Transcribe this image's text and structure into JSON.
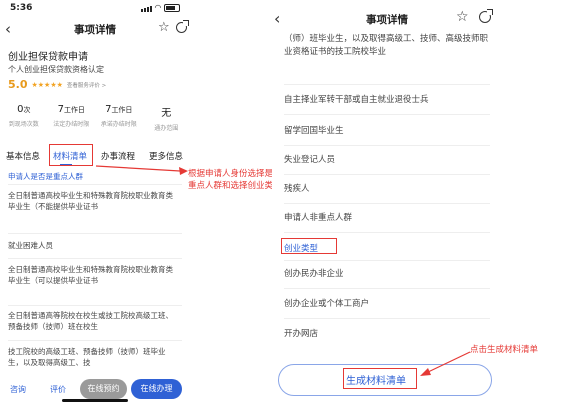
{
  "left": {
    "status": {
      "time": "5:36"
    },
    "navbar": {
      "title": "事项详情"
    },
    "service": {
      "title": "创业担保贷款申请",
      "subtitle": "个人创业担保贷款资格认定",
      "rating": "5.0",
      "stars": "★★★★★",
      "rating_link": "查看服务评价 >"
    },
    "stats": [
      {
        "value": "0",
        "unit": "次",
        "label": "到现场次数"
      },
      {
        "value": "7",
        "unit": "工作日",
        "label": "法定办结时限"
      },
      {
        "value": "7",
        "unit": "工作日",
        "label": "承诺办结时限"
      },
      {
        "value": "无",
        "unit": "",
        "label": "通办范围"
      }
    ],
    "tabs": [
      "基本信息",
      "材料清单",
      "办事流程",
      "更多信息"
    ],
    "section_header": "申请人是否是重点人群",
    "options": [
      "全日制普通高校毕业生和特殊教育院校职业教育类毕业生（不能提供毕业证书",
      "就业困难人员",
      "全日制普通高校毕业生和特殊教育院校职业教育类毕业生（可以提供毕业证书",
      "全日制普通高等院校在校生或技工院校高级工班、预备技师（技师）班在校生",
      "技工院校的高级工班、预备技师（技师）班毕业生，以及取得高级工、技"
    ],
    "bottom": {
      "consult": "咨询",
      "review": "评价",
      "booking": "在线预约",
      "online": "在线办理"
    }
  },
  "annotation_left": "根据申请人身份选择是否重点人群和选择创业类型",
  "right": {
    "navbar": {
      "title": "事项详情"
    },
    "top_text": "（师）班毕业生，以及取得高级工、技师、高级技师职业资格证书的技工院校毕业",
    "options": [
      "自主择业军转干部或自主就业退役士兵",
      "留学回国毕业生",
      "失业登记人员",
      "残疾人",
      "申请人非重点人群"
    ],
    "section_header": "创业类型",
    "types": [
      "创办民办非企业",
      "创办企业或个体工商户",
      "开办网店"
    ],
    "generate_button": "生成材料清单"
  },
  "annotation_right": "点击生成材料清单",
  "colors": {
    "accent": "#2f61d5",
    "annotation": "#e53935",
    "rating": "#e89a1c"
  }
}
